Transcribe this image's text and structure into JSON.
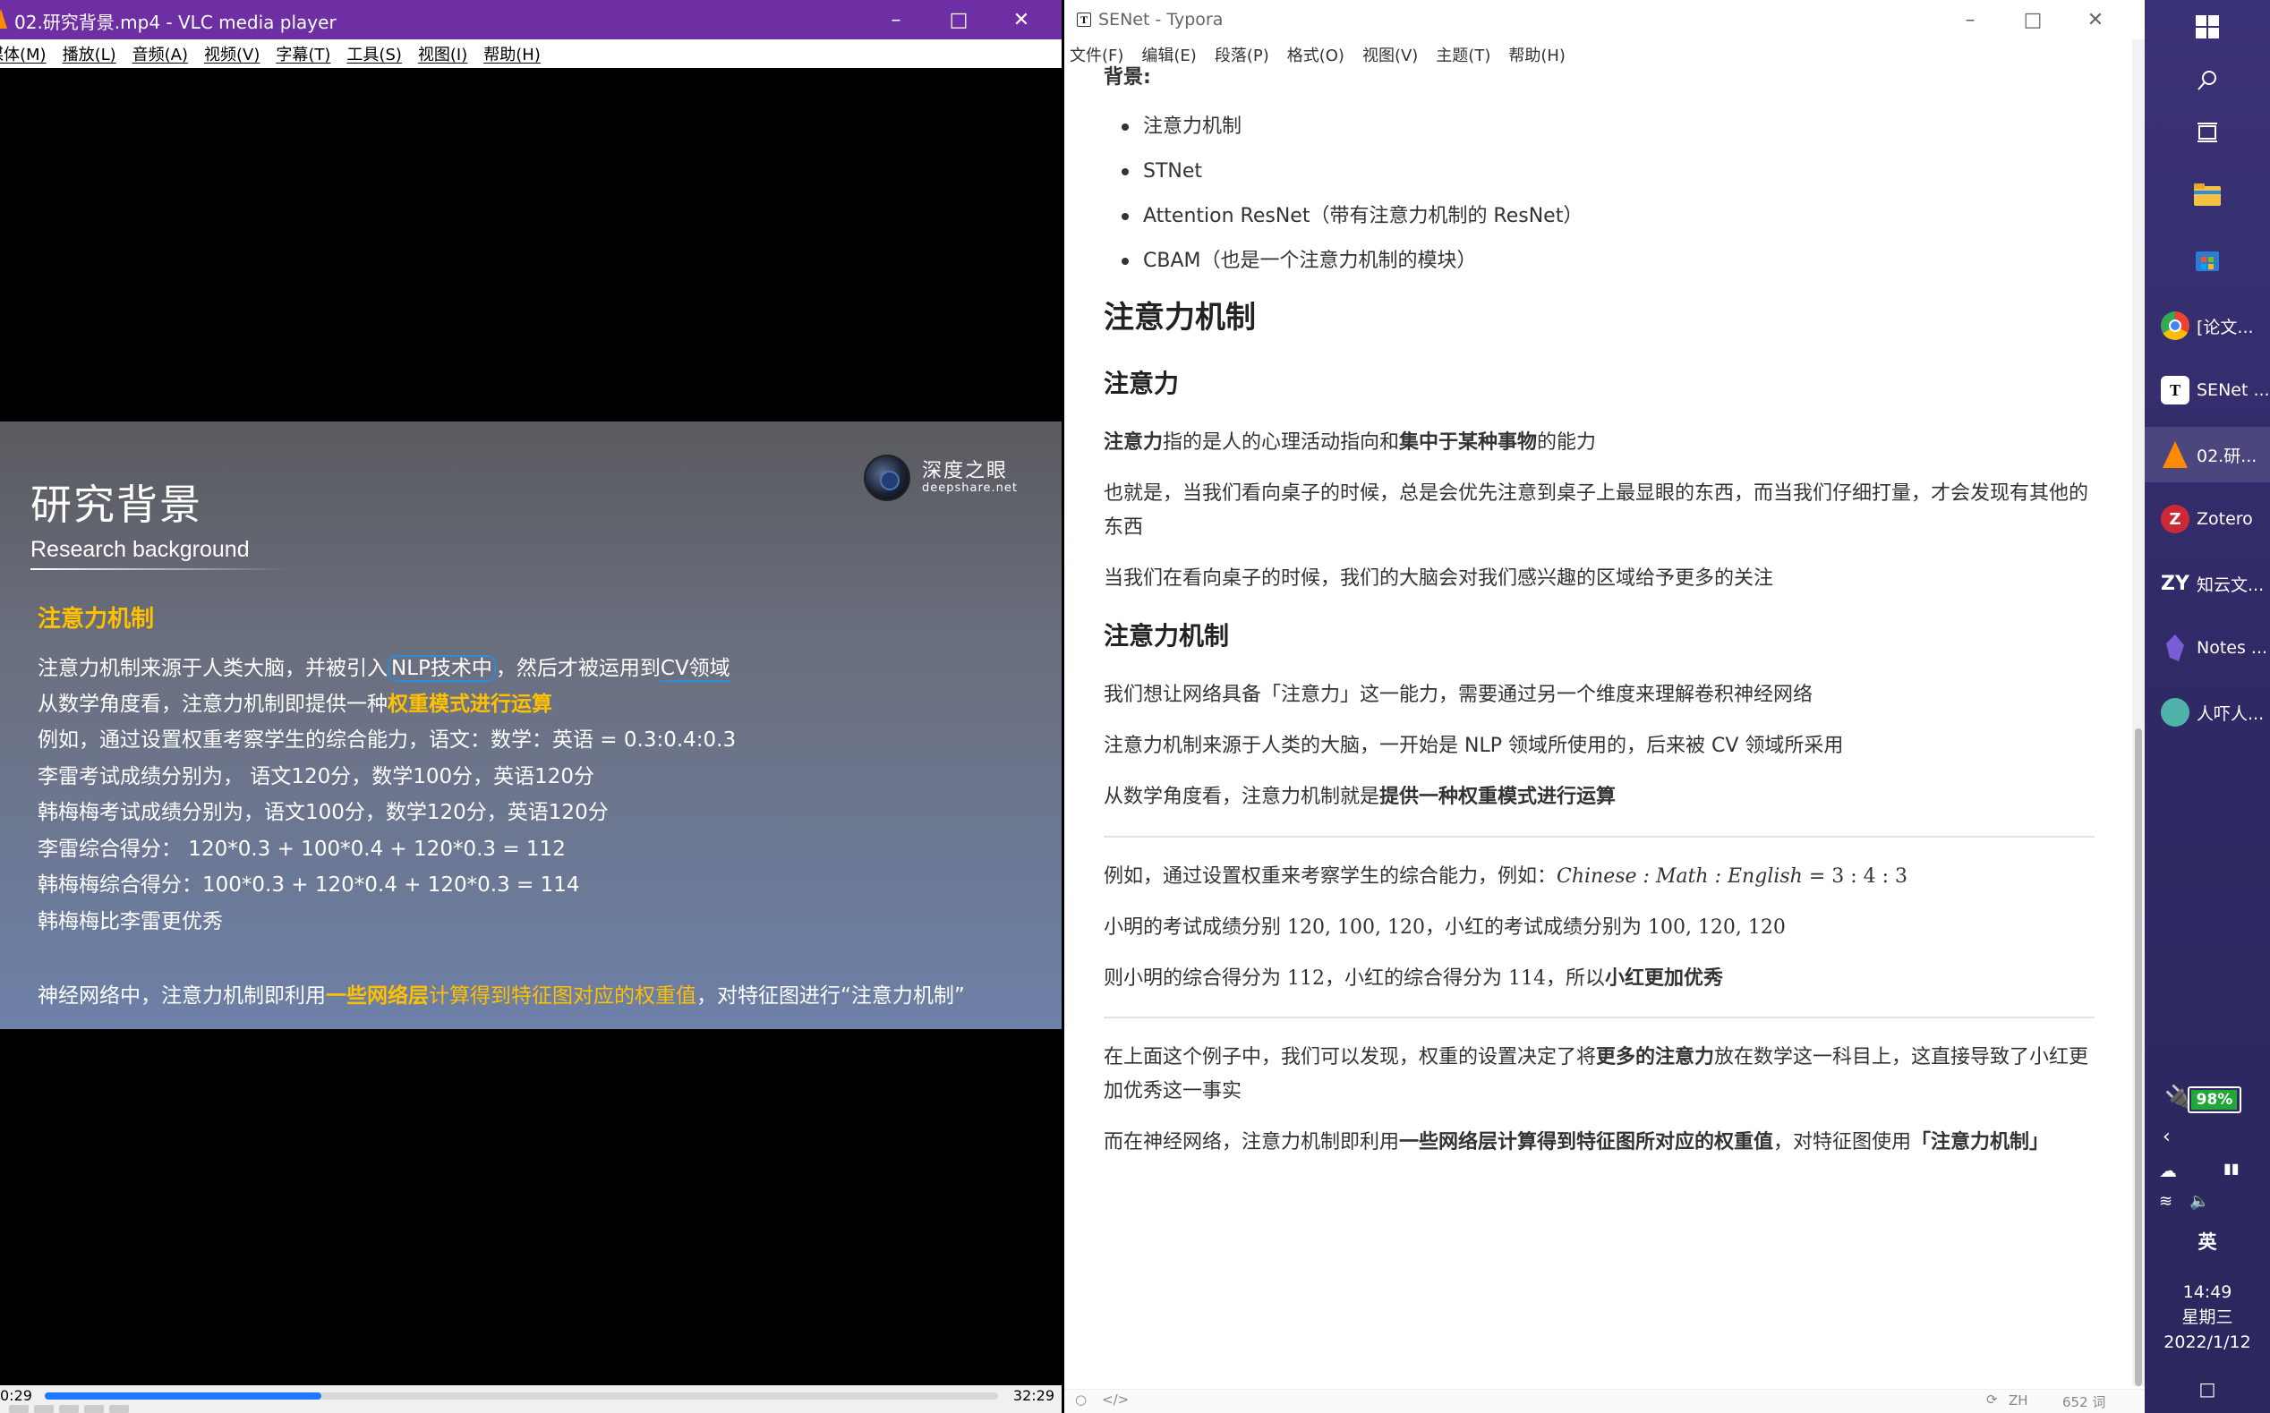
{
  "vlc": {
    "title": "02.研究背景.mp4 - VLC media player",
    "menu": [
      "媒体(M)",
      "播放(L)",
      "音频(A)",
      "视频(V)",
      "字幕(T)",
      "工具(S)",
      "视图(I)",
      "帮助(H)"
    ],
    "time_elapsed": "0:29",
    "time_total": "32:29",
    "seek_progress": 0.29,
    "slide": {
      "title": "研究背景",
      "subtitle": "Research background",
      "brand": "深度之眼",
      "brand_url": "deepshare.net",
      "section": "注意力机制",
      "line1_a": "注意力机制来源于人类大脑，并被引入",
      "line1_b": "NLP技术中",
      "line1_c": "，然后才被运用到",
      "line1_d": "CV领域",
      "line2_a": "从数学角度看，注意力机制即提供一种",
      "line2_b": "权重模式进行运算",
      "line3": "例如，通过设置权重考察学生的综合能力，语文：数学：英语 = 0.3:0.4:0.3",
      "line4": "李雷考试成绩分别为，    语文120分，数学100分，英语120分",
      "line5": "韩梅梅考试成绩分别为，语文100分，数学120分，英语120分",
      "line6": "李雷综合得分：    120*0.3 + 100*0.4 + 120*0.3 = 112",
      "line7": "韩梅梅综合得分：100*0.3 + 120*0.4 + 120*0.3 = 114",
      "line8": "韩梅梅比李雷更优秀",
      "line9_a": "神经网络中，注意力机制即利用",
      "line9_b": "一些网络层",
      "line9_c": "计算得到特征图对应的权重值",
      "line9_d": "，对特征图进行“注意力机制”"
    }
  },
  "typora": {
    "title": "SENet - Typora",
    "menu": [
      "文件(F)",
      "编辑(E)",
      "段落(P)",
      "格式(O)",
      "视图(V)",
      "主题(T)",
      "帮助(H)"
    ],
    "bg_heading": "背景:",
    "bullets": [
      "注意力机制",
      "STNet",
      "Attention ResNet（带有注意力机制的 ResNet）",
      "CBAM（也是一个注意力机制的模块）"
    ],
    "h2": "注意力机制",
    "h3a": "注意力",
    "p1_b1": "注意力",
    "p1_t1": "指的是人的心理活动指向和",
    "p1_b2": "集中于某种事物",
    "p1_t2": "的能力",
    "p2": "也就是，当我们看向桌子的时候，总是会优先注意到桌子上最显眼的东西，而当我们仔细打量，才会发现有其他的东西",
    "p3": "当我们在看向桌子的时候，我们的大脑会对我们感兴趣的区域给予更多的关注",
    "h3b": "注意力机制",
    "p4": "我们想让网络具备「注意力」这一能力，需要通过另一个维度来理解卷积神经网络",
    "p5": "注意力机制来源于人类的大脑，一开始是 NLP 领域所使用的，后来被 CV 领域所采用",
    "p6_t": "从数学角度看，注意力机制就是",
    "p6_b": "提供一种权重模式进行运算",
    "p7_t": "例如，通过设置权重来考察学生的综合能力，例如：",
    "p7_m": "Chinese : Math : English",
    "p7_n": " = 3 : 4 : 3",
    "p8_t1": "小明的考试成绩分别 ",
    "p8_m1": "120, 100, 120",
    "p8_t2": "，小红的考试成绩分别为 ",
    "p8_m2": "100, 120, 120",
    "p9_t1": "则小明的综合得分为 ",
    "p9_m1": "112",
    "p9_t2": "，小红的综合得分为 ",
    "p9_m2": "114",
    "p9_t3": "，所以",
    "p9_b": "小红更加优秀",
    "p10_t1": "在上面这个例子中，我们可以发现，权重的设置决定了将",
    "p10_b": "更多的注意力",
    "p10_t2": "放在数学这一科目上，这直接导致了小红更加优秀这一事实",
    "p11_t1": "而在神经网络，注意力机制即利用",
    "p11_b1": "一些网络层计算得到特征图所对应的权重值",
    "p11_t2": "，对特征图使用",
    "p11_b2": "「注意力机制」",
    "status_lang": "ZH",
    "status_words": "652 词"
  },
  "taskbar": {
    "apps": [
      {
        "icon": "chrome-icon",
        "label": "[论文...",
        "color": "#ea4335"
      },
      {
        "icon": "typora-icon",
        "label": "SENet ...",
        "color": "#ffffff"
      },
      {
        "icon": "vlc-icon",
        "label": "02.研...",
        "color": "#ff8a00"
      },
      {
        "icon": "zotero-icon",
        "label": "Zotero",
        "color": "#cc2936"
      },
      {
        "icon": "zhiyun-icon",
        "label": "知云文...",
        "color": "#ffffff"
      },
      {
        "icon": "obsidian-icon",
        "label": "Notes ...",
        "color": "#7c5cd6"
      },
      {
        "icon": "wechat-avatar-icon",
        "label": "人吓人...",
        "color": "#4fb3a9"
      }
    ],
    "battery": "98%",
    "battery_level": 0.98,
    "ime": "英",
    "time": "14:49",
    "weekday": "星期三",
    "date": "2022/1/12"
  }
}
